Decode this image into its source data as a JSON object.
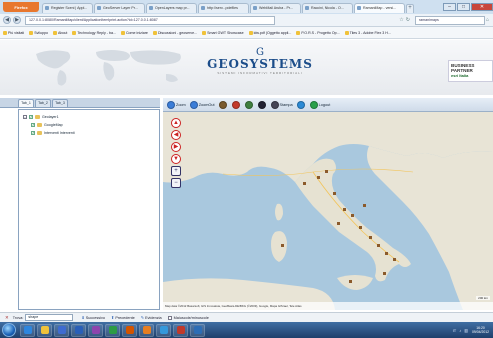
{
  "browser": {
    "firefox_label": "Firefox",
    "tabs": [
      {
        "label": "Register Sceni | Appl...",
        "active": false
      },
      {
        "label": "GeoServer Layer Pr...",
        "active": false
      },
      {
        "label": "OpenLayers map pr...",
        "active": false
      },
      {
        "label": "http://serv...pdefiles",
        "active": false
      },
      {
        "label": "WebMail Aruba - Pr...",
        "active": false
      },
      {
        "label": "Raccini, Nicola - O...",
        "active": false
      },
      {
        "label": "RamaniMap - versi...",
        "active": true
      }
    ],
    "newtab_label": "+",
    "window_controls": [
      "–",
      "□",
      "✕"
    ],
    "url": "127.0.0.1:8080/RamaniMap/client/ApplicationItem!print.action?id=127.0.0.1:8087",
    "search_placeholder": "ramanimaps",
    "nav_glyphs": {
      "back": "◀",
      "forward": "▶",
      "star": "☆",
      "reload": "↻",
      "home": "⌂"
    }
  },
  "bookmarks": [
    "Più visitati",
    "Sviluppo",
    "About",
    "Technology Reply - ba...",
    "Come iniziare",
    "Discussioni - geoserve...",
    "Smart GWT Showcase",
    "idw.pdf (Oggetto appli...",
    "P.O.R.S - Progetto Op...",
    "Tiles 3 - Adobe Flex 3 H..."
  ],
  "app": {
    "logo_mark": "G",
    "brand": "GEOSYSTEMS",
    "tagline": "SISTEMI INFORMATIVI TERRITORIALI",
    "partner_line1": "BUSINESS",
    "partner_line2": "PARTNER",
    "partner_brand": "esri Italia",
    "tabs": [
      "Tab_1",
      "Tab_2",
      "Tab_3"
    ],
    "tree": {
      "root": "Geolayer1",
      "children": [
        "GoogleMap",
        "Interventi Interventi"
      ]
    },
    "toolbar": [
      {
        "label": "Zoom",
        "color": "#3b7dd8"
      },
      {
        "label": "ZoomOut",
        "color": "#3b7dd8"
      },
      {
        "label": "",
        "color": "#7a5b2f"
      },
      {
        "label": "",
        "color": "#c33a2c"
      },
      {
        "label": "",
        "color": "#3f7f3f"
      },
      {
        "label": "",
        "color": "#223"
      },
      {
        "label": "Stampa",
        "color": "#445"
      },
      {
        "label": "",
        "color": "#2b8ad6"
      },
      {
        "label": "Logout",
        "color": "#2aa04a"
      }
    ],
    "map": {
      "attribution": "Map data ©2012 Basarsoft, GIS Innovatsia, GeoBasis-DE/BKG (©2009), Google, Mapa GISrael, Tele Atlas",
      "scale": "200 km",
      "controls": [
        "▲",
        "◀",
        "▶",
        "▼",
        "+",
        "−"
      ]
    }
  },
  "findbar": {
    "close": "✕",
    "label": "Trova:",
    "value": "shape",
    "next": "Successivo",
    "prev": "Precedente",
    "highlight": "Evidenzia",
    "match_case": "Maiuscole/minuscole"
  },
  "taskbar": {
    "apps": [
      {
        "name": "ie",
        "color": "#2e86de"
      },
      {
        "name": "explorer",
        "color": "#f0c23a"
      },
      {
        "name": "media",
        "color": "#3e6bd0"
      },
      {
        "name": "word",
        "color": "#2a5fb8"
      },
      {
        "name": "app5",
        "color": "#8e44ad"
      },
      {
        "name": "excel",
        "color": "#2e9b45"
      },
      {
        "name": "app7",
        "color": "#d35400"
      },
      {
        "name": "firefox",
        "color": "#e67e22"
      },
      {
        "name": "app9",
        "color": "#3498db"
      },
      {
        "name": "pdf",
        "color": "#c0392b"
      },
      {
        "name": "outlook",
        "color": "#2d6db5"
      }
    ],
    "lang": "IT",
    "time": "16:20",
    "date": "09/04/2012"
  }
}
